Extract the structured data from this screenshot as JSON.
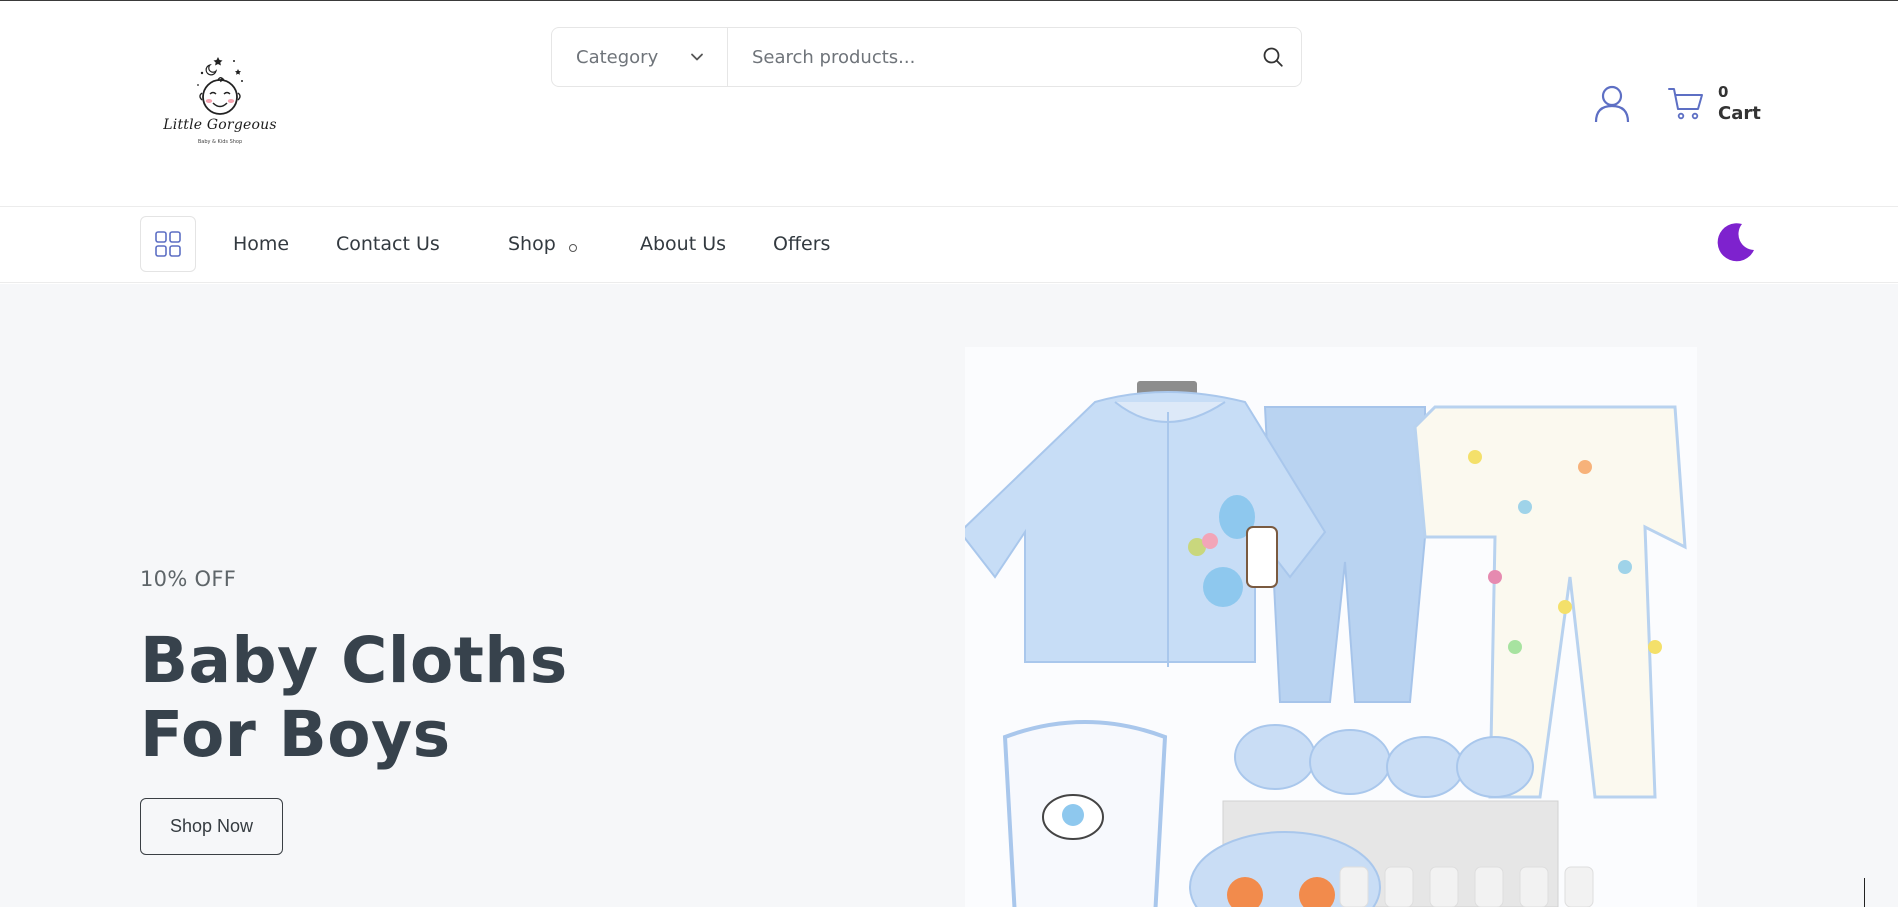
{
  "brand": {
    "name": "Little Gorgeous",
    "tagline": "Baby & Kids Shop"
  },
  "search": {
    "category_label": "Category",
    "placeholder": "Search products..."
  },
  "header": {
    "cart_count": "0",
    "cart_label": "Cart"
  },
  "nav": {
    "items": [
      {
        "label": "Home"
      },
      {
        "label": "Contact Us"
      },
      {
        "label": "Shop"
      },
      {
        "label": "About Us"
      },
      {
        "label": "Offers"
      }
    ]
  },
  "hero": {
    "offer": "10% OFF",
    "title": "Baby Cloths For Boys",
    "button": "Shop Now"
  },
  "icons": {
    "logo": "baby-face-logo",
    "category_chevron": "chevron-down-icon",
    "search": "search-icon",
    "user": "user-icon",
    "cart": "cart-icon",
    "grid": "grid-icon",
    "theme": "moon-icon"
  },
  "colors": {
    "accent_blue": "#5d6fc4",
    "moon_purple": "#7e22ce",
    "hero_bg": "#f6f7f9",
    "text_dark": "#37424c"
  }
}
